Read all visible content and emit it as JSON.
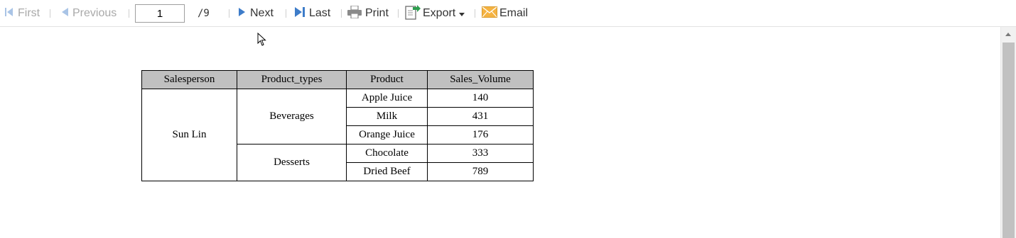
{
  "toolbar": {
    "first": "First",
    "previous": "Previous",
    "page_value": "1",
    "page_total": "/9",
    "next": "Next",
    "last": "Last",
    "print": "Print",
    "export": "Export",
    "email": "Email"
  },
  "colors": {
    "nav_blue": "#3d7cc9",
    "disabled_blue": "#a9c4e6",
    "header_gray": "#c0c0c0",
    "email_orange": "#f5b342",
    "export_green": "#2e9e4f"
  },
  "icons": [
    "first-icon",
    "previous-icon",
    "next-icon",
    "last-icon",
    "print-icon",
    "export-icon",
    "email-icon"
  ],
  "table": {
    "headers": [
      "Salesperson",
      "Product_types",
      "Product",
      "Sales_Volume"
    ],
    "salesperson": "Sun Lin",
    "groups": [
      {
        "type": "Beverages",
        "rows": [
          {
            "product": "Apple Juice",
            "volume": "140"
          },
          {
            "product": "Milk",
            "volume": "431"
          },
          {
            "product": "Orange Juice",
            "volume": "176"
          }
        ]
      },
      {
        "type": "Desserts",
        "rows": [
          {
            "product": "Chocolate",
            "volume": "333"
          },
          {
            "product": "Dried Beef",
            "volume": "789"
          }
        ]
      }
    ]
  }
}
